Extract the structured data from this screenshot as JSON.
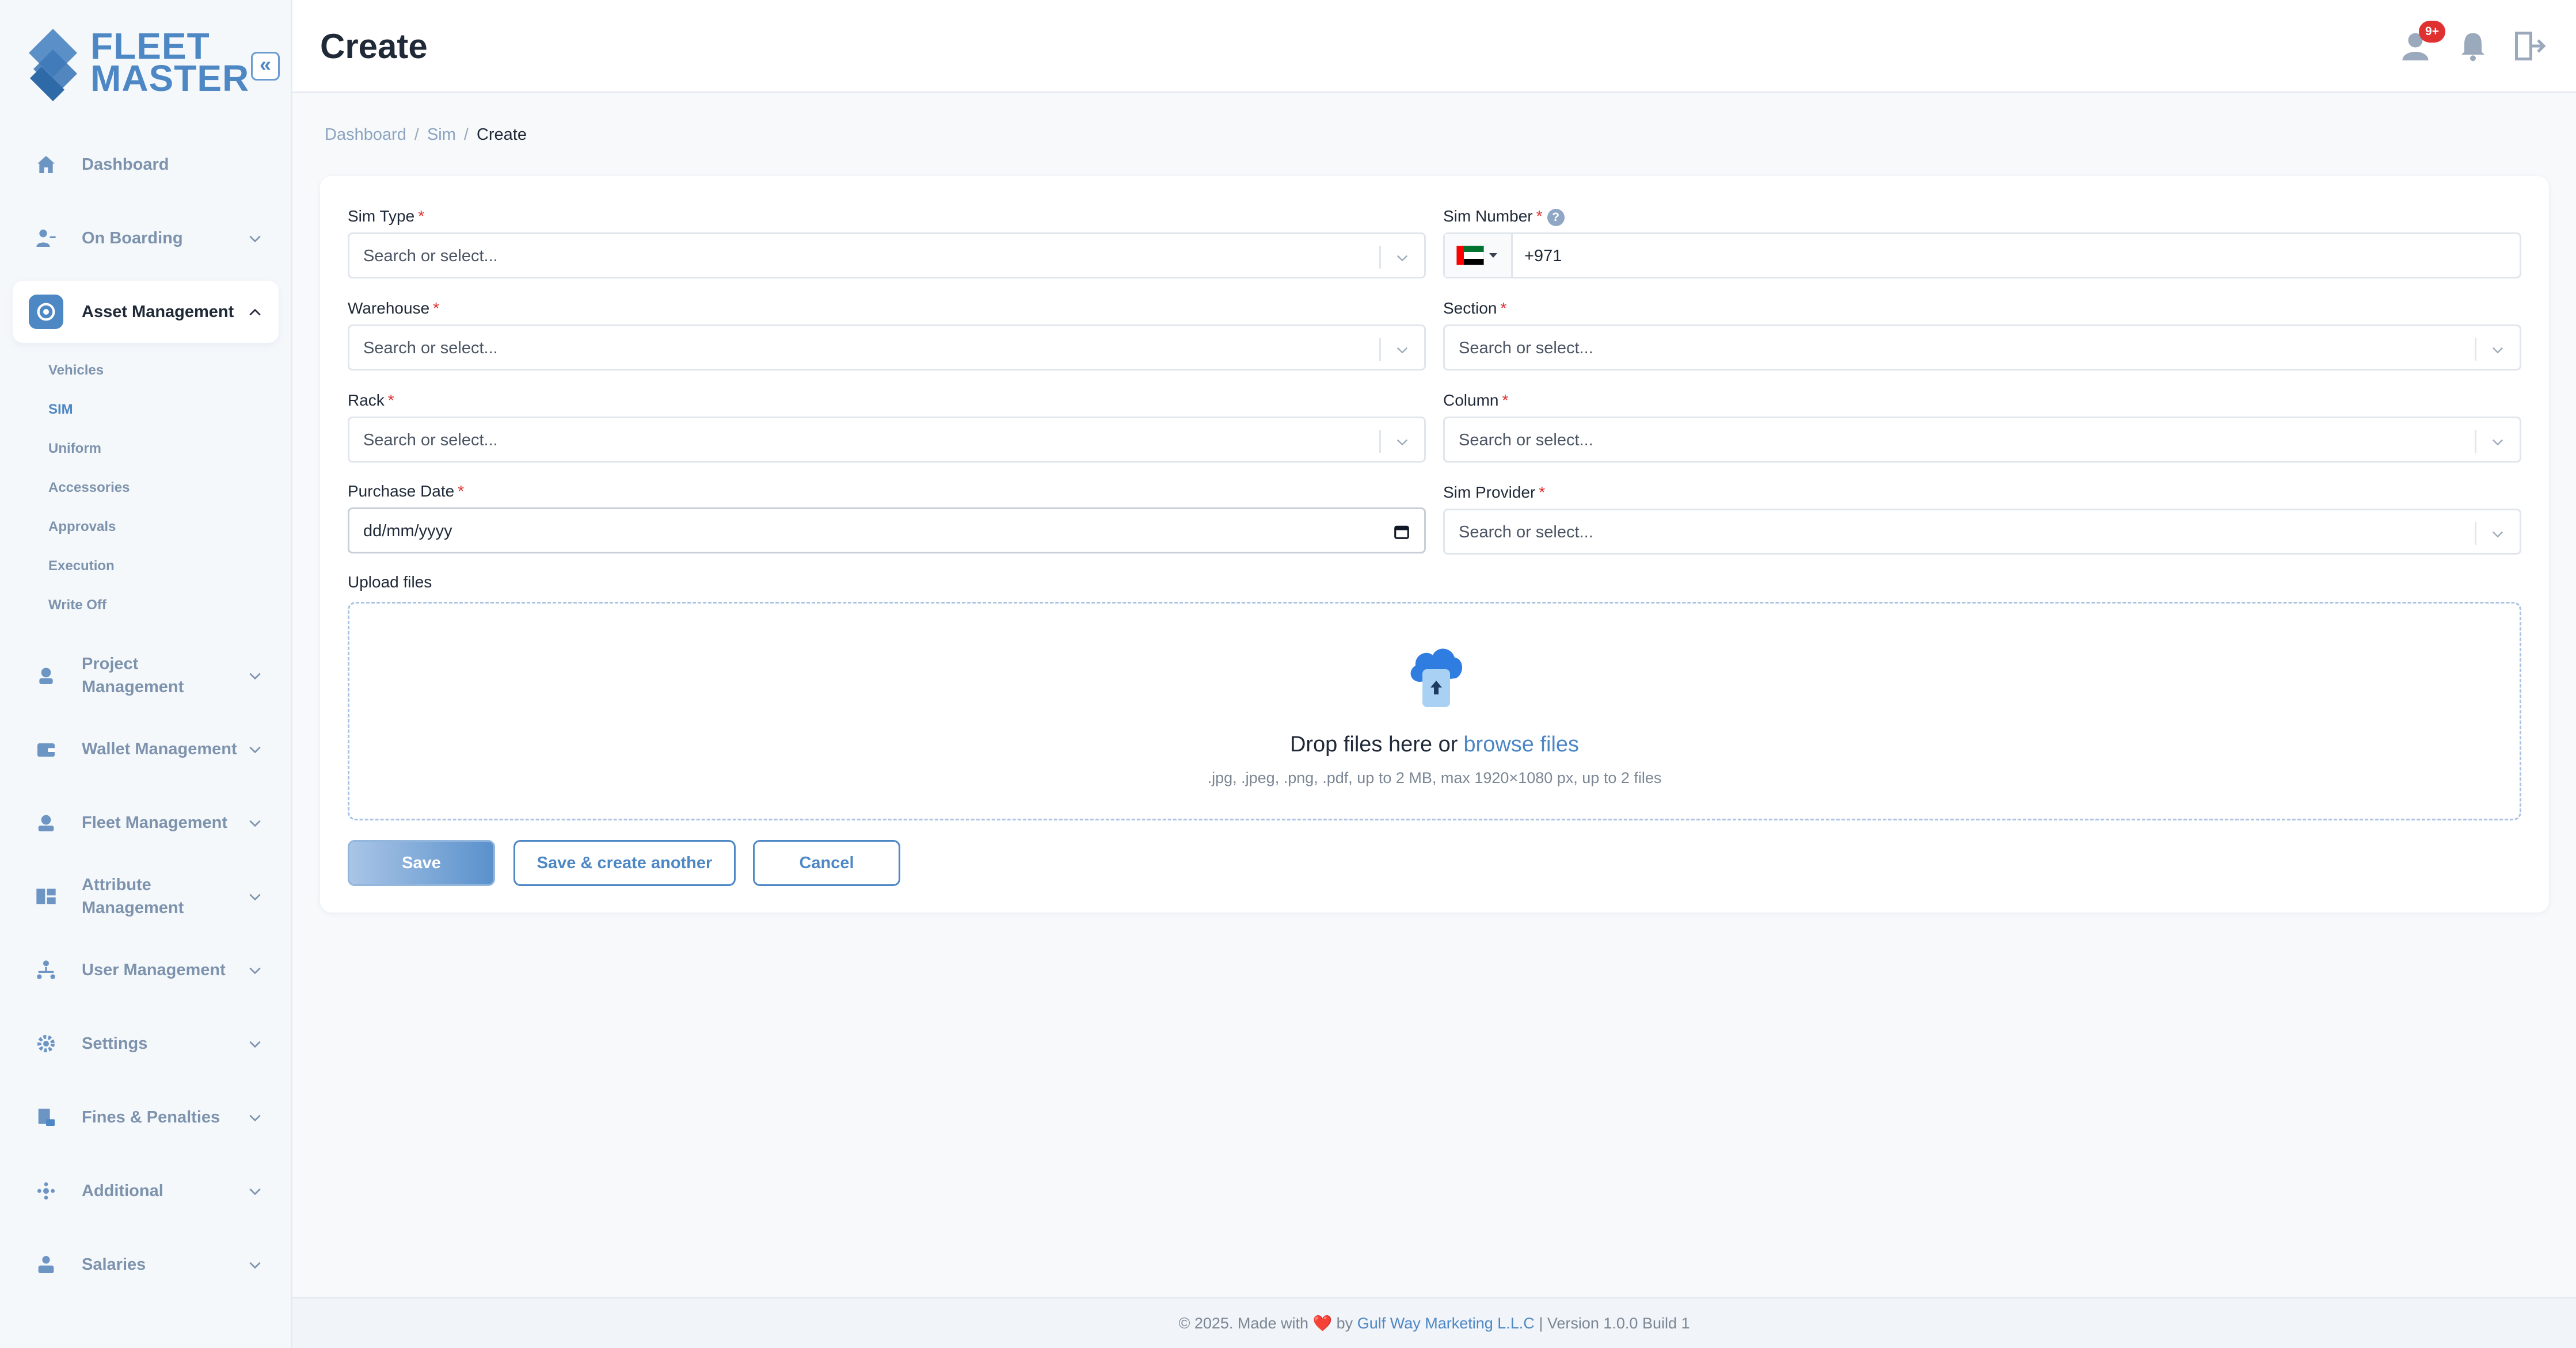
{
  "brand": {
    "line1": "FLEET",
    "line2": "MASTER",
    "color": "#4d87c4"
  },
  "sidebar": {
    "collapse_glyph": "«",
    "items": [
      {
        "label": "Dashboard",
        "icon": "home-icon"
      },
      {
        "label": "On Boarding",
        "icon": "onboarding-icon"
      },
      {
        "label": "Asset Management",
        "icon": "asset-icon",
        "expanded": true,
        "children": [
          "Vehicles",
          "SIM",
          "Uniform",
          "Accessories",
          "Approvals",
          "Execution",
          "Write Off"
        ],
        "active_child": "SIM"
      },
      {
        "label": "Project Management",
        "icon": "project-icon"
      },
      {
        "label": "Wallet Management",
        "icon": "wallet-icon"
      },
      {
        "label": "Fleet Management",
        "icon": "fleet-icon"
      },
      {
        "label": "Attribute Management",
        "icon": "attribute-icon"
      },
      {
        "label": "User Management",
        "icon": "users-icon"
      },
      {
        "label": "Settings",
        "icon": "gear-icon"
      },
      {
        "label": "Fines & Penalties",
        "icon": "fines-icon"
      },
      {
        "label": "Additional",
        "icon": "additional-icon"
      },
      {
        "label": "Salaries",
        "icon": "salaries-icon"
      }
    ]
  },
  "header": {
    "title": "Create",
    "notification_badge": "9+",
    "icons": [
      "user-icon",
      "bell-icon",
      "logout-icon"
    ]
  },
  "breadcrumb": {
    "items": [
      "Dashboard",
      "Sim"
    ],
    "current": "Create",
    "separator": "/"
  },
  "form": {
    "required_mark": "*",
    "sim_type": {
      "label": "Sim Type",
      "placeholder": "Search or select..."
    },
    "sim_number": {
      "label": "Sim Number",
      "value": "+971",
      "help": "?",
      "country": "UAE flag"
    },
    "warehouse": {
      "label": "Warehouse",
      "placeholder": "Search or select..."
    },
    "section": {
      "label": "Section",
      "placeholder": "Search or select..."
    },
    "rack": {
      "label": "Rack",
      "placeholder": "Search or select..."
    },
    "column": {
      "label": "Column",
      "placeholder": "Search or select..."
    },
    "purchase_date": {
      "label": "Purchase Date",
      "value": "dd/mm/yyyy"
    },
    "sim_provider": {
      "label": "Sim Provider",
      "placeholder": "Search or select..."
    },
    "upload": {
      "label": "Upload files",
      "drop_text": "Drop files here or",
      "browse_text": "browse files",
      "hint": ".jpg, .jpeg, .png, .pdf, up to 2 MB, max 1920×1080 px, up to 2 files"
    },
    "buttons": {
      "save": "Save",
      "save_another": "Save & create another",
      "cancel": "Cancel"
    }
  },
  "footer": {
    "prefix": "© 2025. Made with",
    "heart": "❤️",
    "by": "by",
    "company": "Gulf Way Marketing L.L.C",
    "version": "| Version 1.0.0 Build 1"
  }
}
